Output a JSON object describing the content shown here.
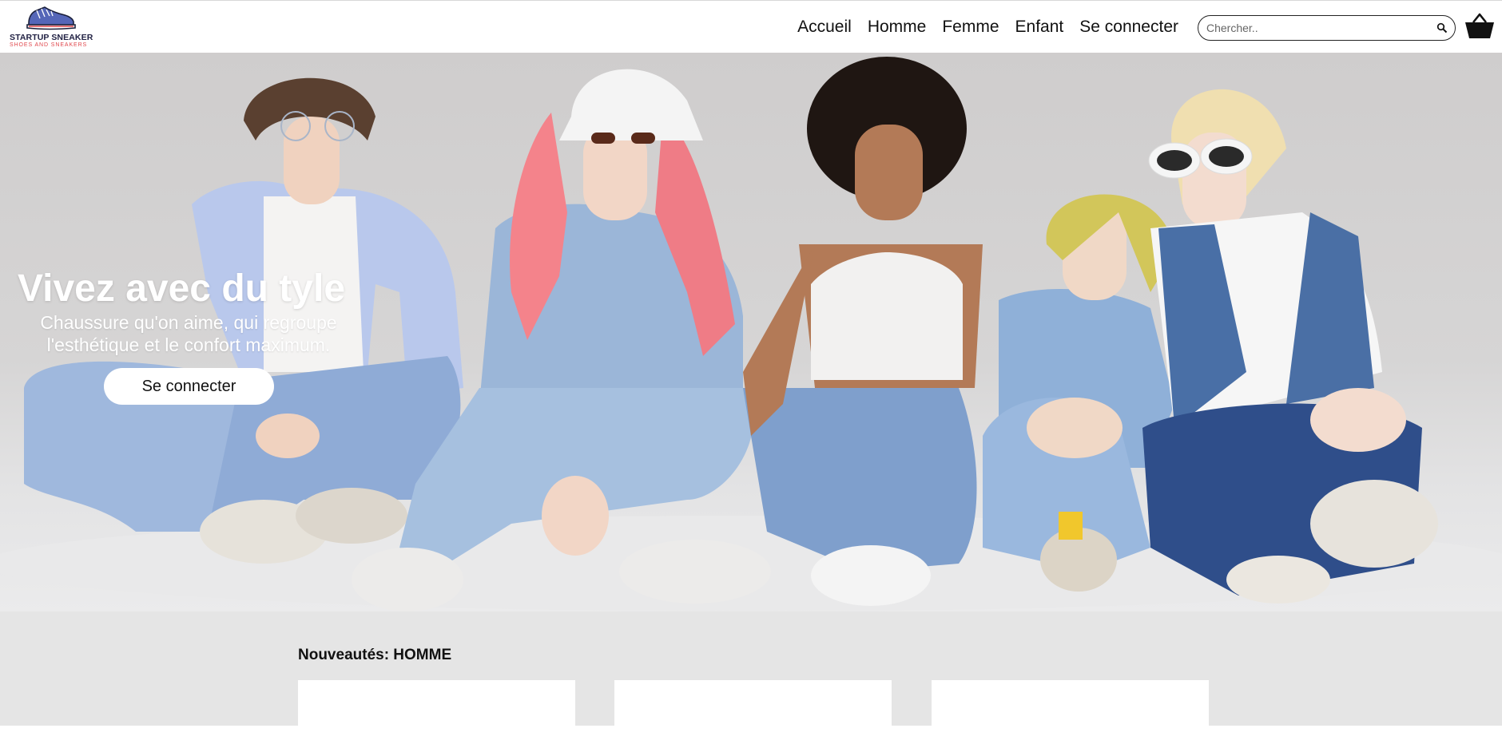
{
  "brand": {
    "name": "STARTUP SNEAKER",
    "tagline": "SHOES AND SNEAKERS",
    "colors": {
      "name": "#222244",
      "tagline": "#e0474c"
    }
  },
  "nav": {
    "items": [
      {
        "label": "Accueil"
      },
      {
        "label": "Homme"
      },
      {
        "label": "Femme"
      },
      {
        "label": "Enfant"
      },
      {
        "label": "Se connecter"
      }
    ]
  },
  "search": {
    "placeholder": "Chercher..",
    "icon": "magnifier-icon"
  },
  "cart": {
    "icon": "basket-icon"
  },
  "hero": {
    "title": "Vivez avec du tyle",
    "subtitle": "Chaussure qu'on aime, qui regroupe l'esthétique et le confort maximum.",
    "cta_label": "Se connecter",
    "image_description_icon": "group-photo"
  },
  "section": {
    "title": "Nouveautés: HOMME",
    "cards": [
      {},
      {},
      {}
    ]
  }
}
